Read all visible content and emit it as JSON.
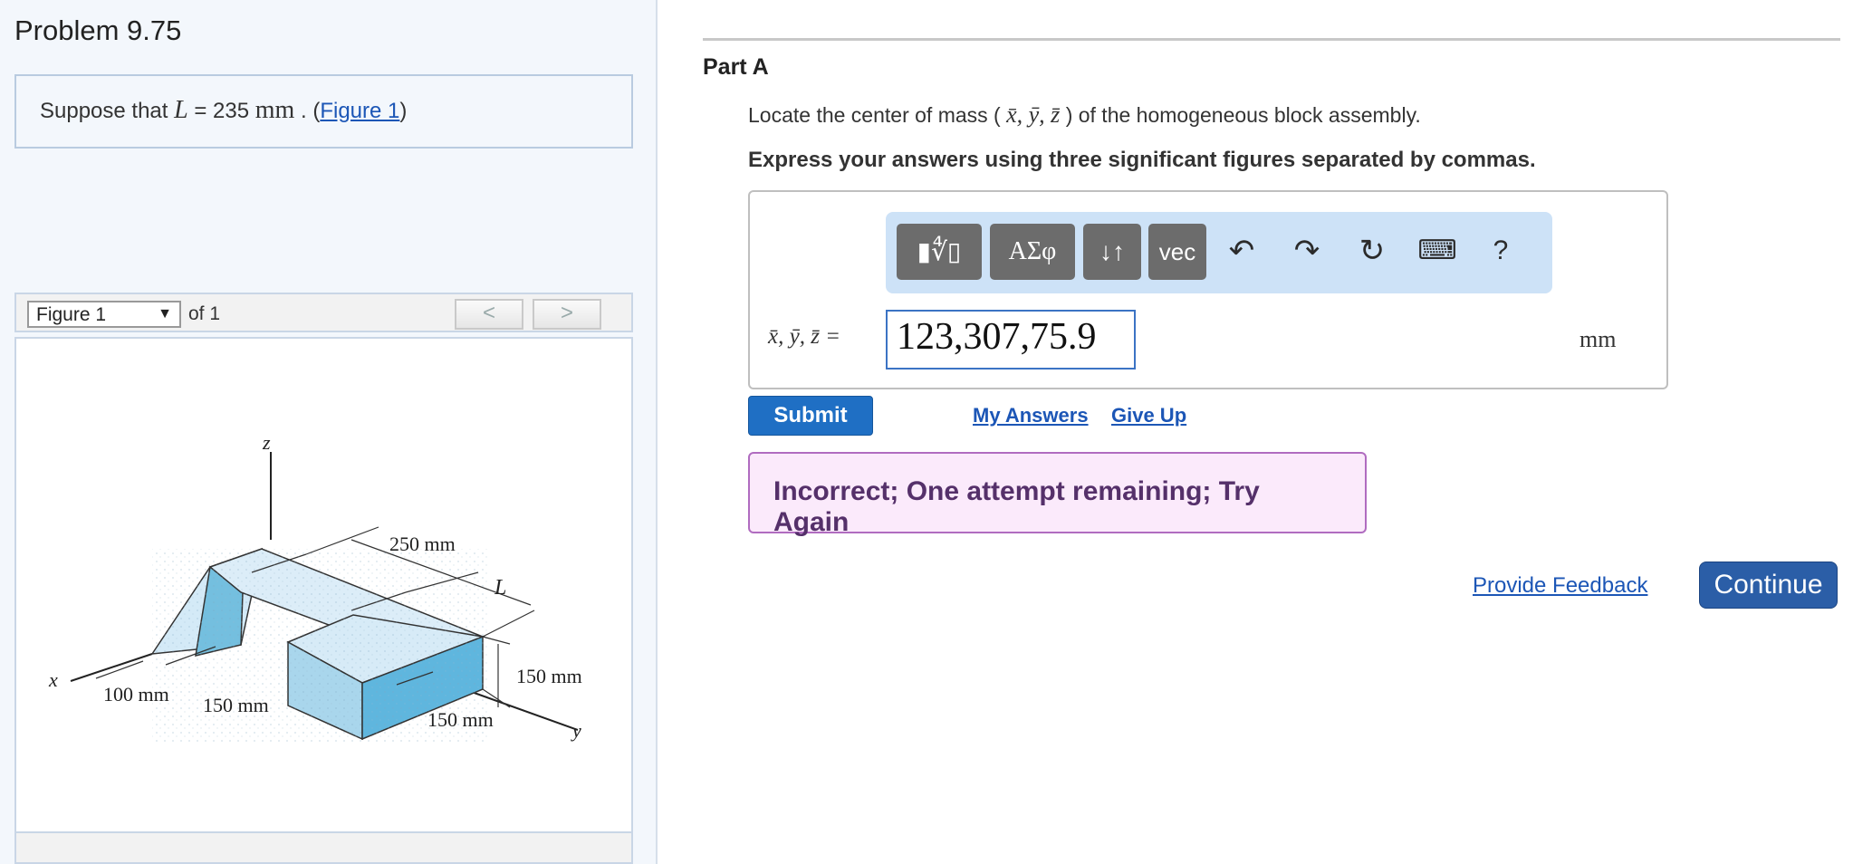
{
  "problem": {
    "title": "Problem 9.75",
    "statement_prefix": "Suppose that",
    "variable": "L",
    "equals_value": "= 235",
    "unit": "mm",
    "figure_link": "Figure 1"
  },
  "figure_viewer": {
    "selected": "Figure 1",
    "of_text": "of 1",
    "prev_label": "<",
    "next_label": ">",
    "labels": {
      "z_axis": "z",
      "x_axis": "x",
      "y_axis": "y",
      "dim_250": "250 mm",
      "dim_L": "L",
      "dim_100": "100 mm",
      "dim_150_a": "150 mm",
      "dim_150_b": "150 mm",
      "dim_150_c": "150 mm"
    }
  },
  "part": {
    "title": "Part A",
    "question_prefix": "Locate the center of mass (",
    "question_vars": "x̄, ȳ, z̄",
    "question_suffix": ") of the homogeneous block assembly.",
    "instruction": "Express your answers using three significant figures separated by commas."
  },
  "toolbar": {
    "templates_label": "▮∜▯",
    "greek_label": "ΑΣφ",
    "arrows_label": "↓↑",
    "vec_label": "vec",
    "undo_icon": "undo-icon",
    "redo_icon": "redo-icon",
    "reset_icon": "reset-icon",
    "keyboard_icon": "keyboard-icon",
    "help_label": "?"
  },
  "answer": {
    "label": "x̄, ȳ, z̄ =",
    "value": "123,307,75.9",
    "unit": "mm"
  },
  "actions": {
    "submit": "Submit",
    "my_answers": "My Answers",
    "give_up": "Give Up",
    "feedback": "Incorrect; One attempt remaining; Try Again",
    "provide_feedback": "Provide Feedback",
    "continue": "Continue"
  },
  "colors": {
    "link": "#1c56b6",
    "submit": "#1f6fc4",
    "continue": "#2b5ea7",
    "feedback_bg": "#fbeafb",
    "feedback_border": "#b06cc0",
    "toolbar_bg": "#cde2f7"
  }
}
